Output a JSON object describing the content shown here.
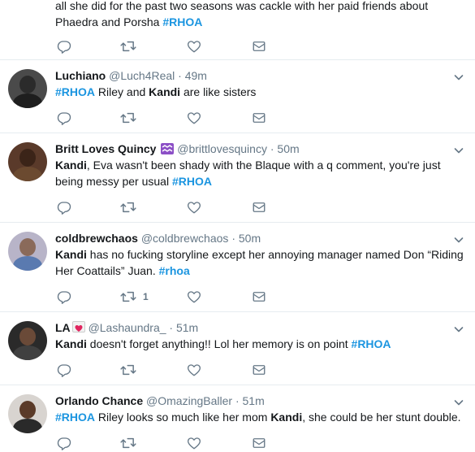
{
  "first_tweet": {
    "text_parts": [
      {
        "t": "all she did for the past two seasons was cackle with her paid friends about",
        "s": "plain"
      },
      {
        "t": "Phaedra and Porsha ",
        "s": "plain"
      },
      {
        "t": "#RHOA",
        "s": "tag"
      }
    ]
  },
  "tweets": [
    {
      "name": "Luchiano",
      "handle": "@Luch4Real",
      "dot": "·",
      "time": "49m",
      "text_parts": [
        {
          "t": "#RHOA",
          "s": "tag"
        },
        {
          "t": " Riley and ",
          "s": "plain"
        },
        {
          "t": "Kandi",
          "s": "b"
        },
        {
          "t": " are like sisters",
          "s": "plain"
        }
      ],
      "retweet_count": ""
    },
    {
      "name": "Britt Loves Quincy",
      "name_emoji": "aquarius-icon",
      "handle": "@brittlovesquincy",
      "dot": "·",
      "time": "50m",
      "text_parts": [
        {
          "t": "Kandi",
          "s": "b"
        },
        {
          "t": ", Eva wasn't been shady with the Blaque with a q comment, you're just being messy per usual ",
          "s": "plain"
        },
        {
          "t": "#RHOA",
          "s": "tag"
        }
      ],
      "retweet_count": ""
    },
    {
      "name": "coldbrewchaos",
      "handle": "@coldbrewchaos",
      "dot": "·",
      "time": "50m",
      "text_parts": [
        {
          "t": "Kandi",
          "s": "b"
        },
        {
          "t": " has no fucking storyline except her annoying manager named Don “Riding Her Coattails” Juan. ",
          "s": "plain"
        },
        {
          "t": "#rhoa",
          "s": "tag"
        }
      ],
      "retweet_count": "1"
    },
    {
      "name": "LA",
      "name_emoji": "love-letter-icon",
      "handle": "@Lashaundra_",
      "dot": "·",
      "time": "51m",
      "text_parts": [
        {
          "t": "Kandi",
          "s": "b"
        },
        {
          "t": " doesn't forget anything!! Lol her memory is on point  ",
          "s": "plain"
        },
        {
          "t": "#RHOA",
          "s": "tag"
        }
      ],
      "retweet_count": ""
    },
    {
      "name": "Orlando Chance",
      "handle": "@OmazingBaller",
      "dot": "·",
      "time": "51m",
      "text_parts": [
        {
          "t": "#RHOA",
          "s": "tag"
        },
        {
          "t": " Riley looks so much like her mom ",
          "s": "plain"
        },
        {
          "t": "Kandi",
          "s": "b"
        },
        {
          "t": ", she could be her stunt double.",
          "s": "plain"
        }
      ],
      "retweet_count": ""
    }
  ],
  "colors": {
    "text": "#14171a",
    "secondary": "#657786",
    "hashtag": "#1b95e0",
    "divider": "#e6ecf0",
    "aquarius_bg": "#8c4fc6",
    "letter_bg": "#f2f2f2",
    "letter_heart": "#e0245e"
  },
  "icons": [
    "reply-icon",
    "retweet-icon",
    "like-icon",
    "direct-message-icon",
    "chevron-down-icon"
  ]
}
